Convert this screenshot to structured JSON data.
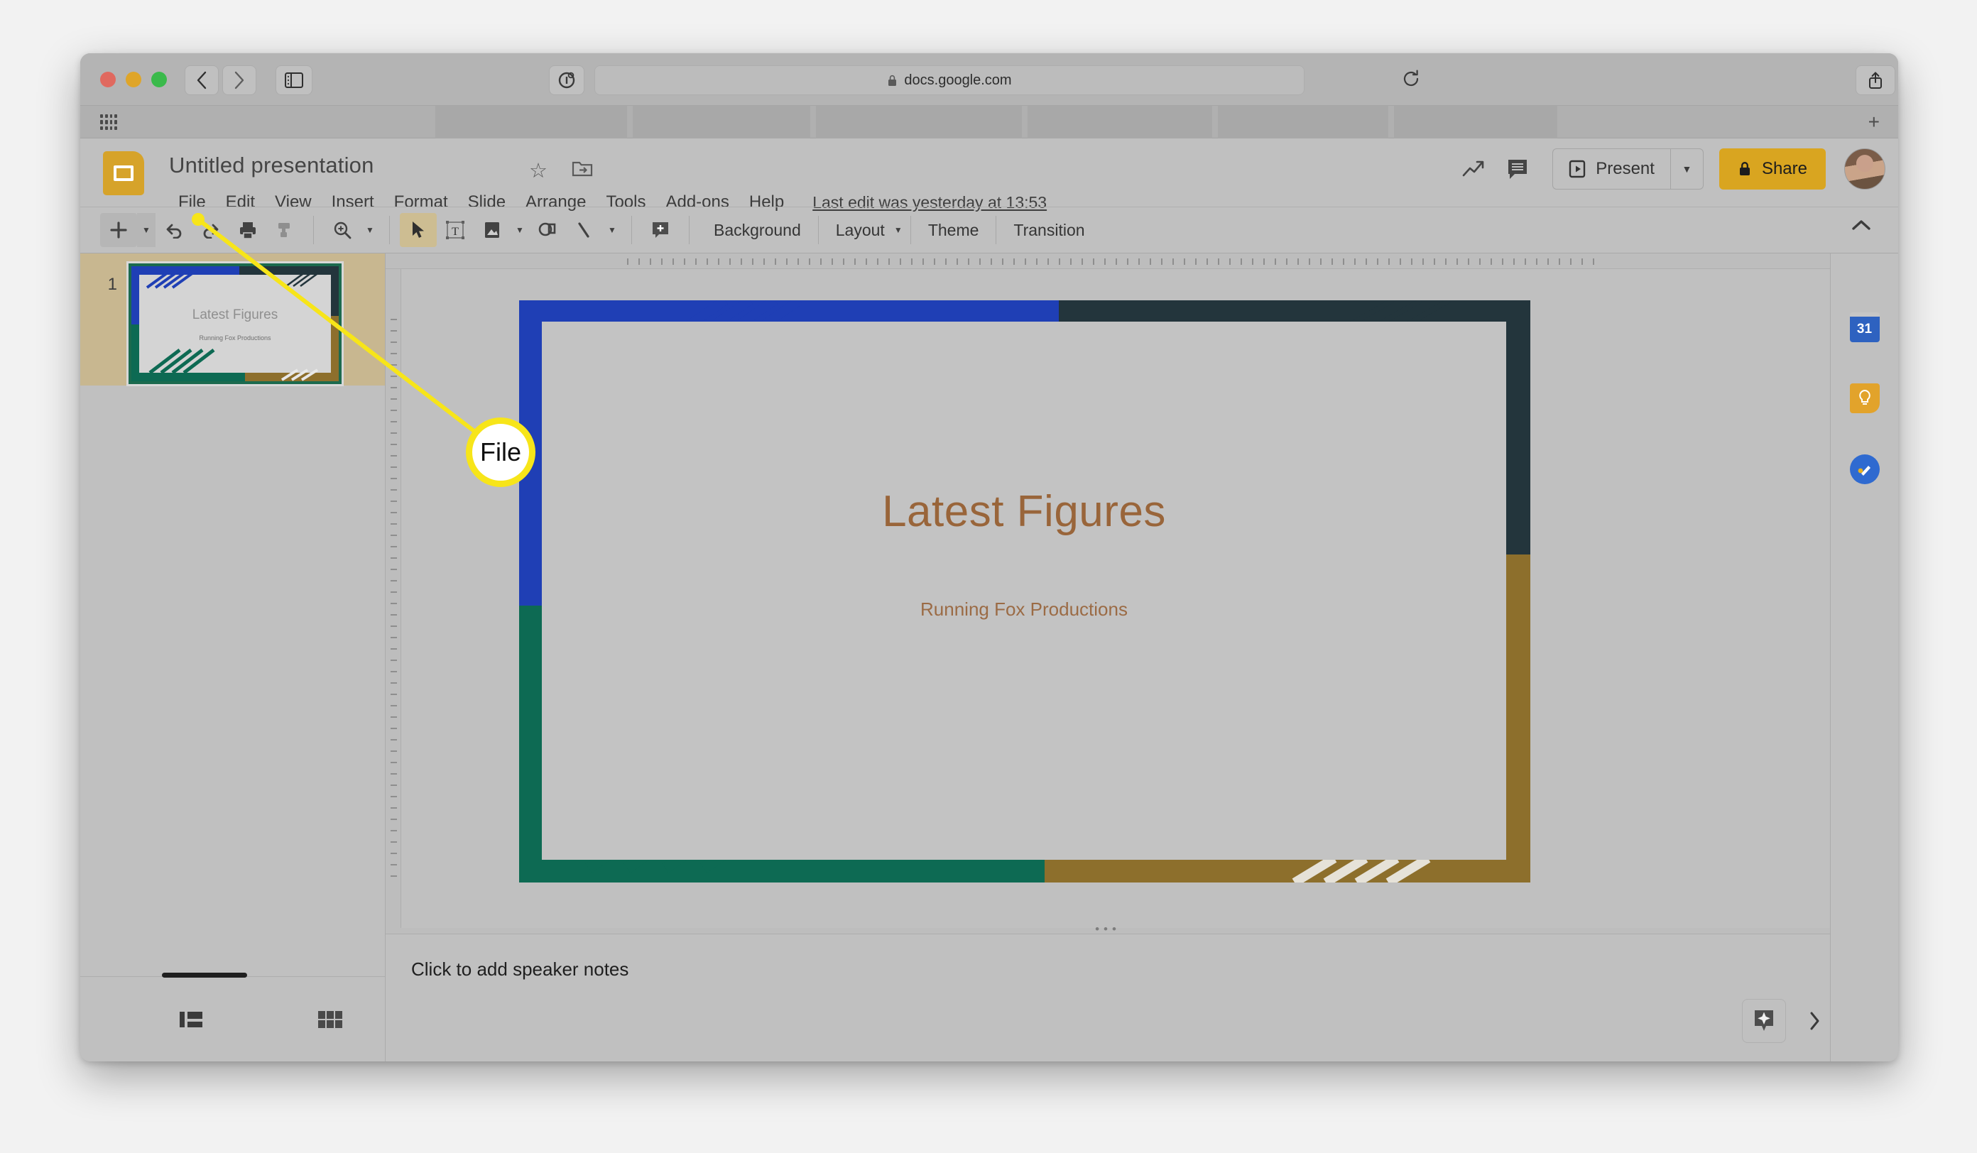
{
  "browser": {
    "url": "docs.google.com",
    "lock_icon": "lock-icon",
    "back_icon": "chevron-left-icon",
    "forward_icon": "chevron-right-icon",
    "sidebar_icon": "sidebar-toggle-icon",
    "reader_icon": "reader-mode-icon",
    "reload_icon": "reload-icon",
    "share_icon": "share-icon",
    "tabs_icon": "tab-overview-icon",
    "newtab_label": "+",
    "apps_icon": "apps-grid-icon"
  },
  "header": {
    "doc_title": "Untitled presentation",
    "star_icon": "star-icon",
    "move_icon": "move-to-folder-icon",
    "logo_icon": "google-slides-logo",
    "last_edit": "Last edit was yesterday at 13:53",
    "menus": [
      {
        "label": "File"
      },
      {
        "label": "Edit"
      },
      {
        "label": "View"
      },
      {
        "label": "Insert"
      },
      {
        "label": "Format"
      },
      {
        "label": "Slide"
      },
      {
        "label": "Arrange"
      },
      {
        "label": "Tools"
      },
      {
        "label": "Add-ons"
      },
      {
        "label": "Help"
      }
    ],
    "trending_icon": "trending-up-icon",
    "comment_icon": "comment-icon",
    "present_label": "Present",
    "present_icon": "present-play-icon",
    "present_caret_icon": "chevron-down-icon",
    "share_label": "Share",
    "share_lock_icon": "lock-icon",
    "avatar_label": "avatar",
    "share_color": "#d9a520"
  },
  "toolbar": {
    "new_slide_icon": "plus-icon",
    "new_slide_caret_icon": "chevron-down-icon",
    "undo_icon": "undo-icon",
    "redo_icon": "redo-icon",
    "print_icon": "print-icon",
    "paint_format_icon": "paint-format-icon",
    "zoom_icon": "zoom-in-icon",
    "zoom_caret_icon": "chevron-down-icon",
    "select_icon": "cursor-arrow-icon",
    "textbox_icon": "text-box-icon",
    "image_icon": "image-icon",
    "image_caret_icon": "chevron-down-icon",
    "shape_icon": "shape-icon",
    "line_icon": "line-icon",
    "line_caret_icon": "chevron-down-icon",
    "comment_icon": "add-comment-icon",
    "background_label": "Background",
    "layout_label": "Layout",
    "layout_caret_icon": "chevron-down-icon",
    "theme_label": "Theme",
    "transition_label": "Transition",
    "collapse_icon": "chevron-up-icon"
  },
  "filmstrip": {
    "slides": [
      {
        "number": "1",
        "title": "Latest Figures",
        "subtitle": "Running Fox Productions"
      }
    ],
    "view_filmstrip_icon": "filmstrip-view-icon",
    "view_grid_icon": "grid-view-icon"
  },
  "slide": {
    "title": "Latest Figures",
    "subtitle": "Running Fox Productions",
    "colors": {
      "background": "#c3c3c3",
      "blue": "#1f3fb5",
      "navy": "#23353c",
      "green": "#0d6a53",
      "gold": "#8d6f2c",
      "title_text": "#99653a",
      "subtitle_text": "#9b6b45"
    }
  },
  "notes": {
    "placeholder": "Click to add speaker notes",
    "explore_icon": "explore-sparkle-icon",
    "expand_icon": "chevron-right-icon",
    "drag_dots_icon": "drag-handle-dots"
  },
  "right_rail": {
    "items": [
      {
        "name": "google-calendar-icon",
        "label": "31"
      },
      {
        "name": "google-keep-icon",
        "label": ""
      },
      {
        "name": "google-tasks-icon",
        "label": ""
      }
    ]
  },
  "callout": {
    "label": "File",
    "highlight_color": "#f7e519"
  }
}
